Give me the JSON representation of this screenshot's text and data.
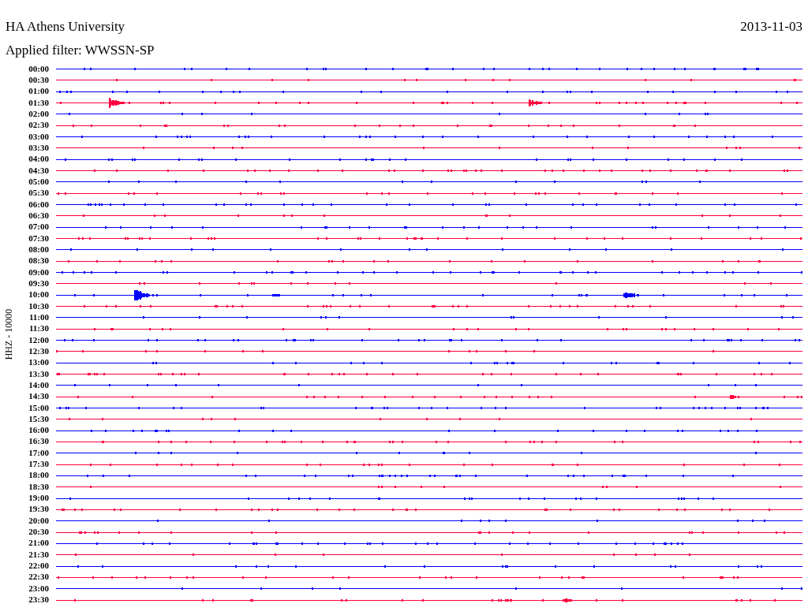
{
  "header": {
    "station": "HA Athens University",
    "date": "2013-11-03",
    "filter": "Applied filter: WWSSN-SP"
  },
  "axis_label": "HHZ - 10000",
  "rows": [
    {
      "time": "00:00",
      "color": "#0000ff"
    },
    {
      "time": "00:30",
      "color": "#ff0040"
    },
    {
      "time": "01:00",
      "color": "#0000ff"
    },
    {
      "time": "01:30",
      "color": "#ff0040"
    },
    {
      "time": "02:00",
      "color": "#0000ff"
    },
    {
      "time": "02:30",
      "color": "#ff0040"
    },
    {
      "time": "03:00",
      "color": "#0000ff"
    },
    {
      "time": "03:30",
      "color": "#ff0040"
    },
    {
      "time": "04:00",
      "color": "#0000ff"
    },
    {
      "time": "04:30",
      "color": "#ff0040"
    },
    {
      "time": "05:00",
      "color": "#0000ff"
    },
    {
      "time": "05:30",
      "color": "#ff0040"
    },
    {
      "time": "06:00",
      "color": "#0000ff"
    },
    {
      "time": "06:30",
      "color": "#ff0040"
    },
    {
      "time": "07:00",
      "color": "#0000ff"
    },
    {
      "time": "07:30",
      "color": "#ff0040"
    },
    {
      "time": "08:00",
      "color": "#0000ff"
    },
    {
      "time": "08:30",
      "color": "#ff0040"
    },
    {
      "time": "09:00",
      "color": "#0000ff"
    },
    {
      "time": "09:30",
      "color": "#ff0040"
    },
    {
      "time": "10:00",
      "color": "#0000ff"
    },
    {
      "time": "10:30",
      "color": "#ff0040"
    },
    {
      "time": "11:00",
      "color": "#0000ff"
    },
    {
      "time": "11:30",
      "color": "#ff0040"
    },
    {
      "time": "12:00",
      "color": "#0000ff"
    },
    {
      "time": "12:30",
      "color": "#ff0040"
    },
    {
      "time": "13:00",
      "color": "#0000ff"
    },
    {
      "time": "13:30",
      "color": "#ff0040"
    },
    {
      "time": "14:00",
      "color": "#0000ff"
    },
    {
      "time": "14:30",
      "color": "#ff0040"
    },
    {
      "time": "15:00",
      "color": "#0000ff"
    },
    {
      "time": "15:30",
      "color": "#ff0040"
    },
    {
      "time": "16:00",
      "color": "#0000ff"
    },
    {
      "time": "16:30",
      "color": "#ff0040"
    },
    {
      "time": "17:00",
      "color": "#0000ff"
    },
    {
      "time": "17:30",
      "color": "#ff0040"
    },
    {
      "time": "18:00",
      "color": "#0000ff"
    },
    {
      "time": "18:30",
      "color": "#ff0040"
    },
    {
      "time": "19:00",
      "color": "#0000ff"
    },
    {
      "time": "19:30",
      "color": "#ff0040"
    },
    {
      "time": "20:00",
      "color": "#0000ff"
    },
    {
      "time": "20:30",
      "color": "#ff0040"
    },
    {
      "time": "21:00",
      "color": "#0000ff"
    },
    {
      "time": "21:30",
      "color": "#ff0040"
    },
    {
      "time": "22:00",
      "color": "#0000ff"
    },
    {
      "time": "22:30",
      "color": "#ff0040"
    },
    {
      "time": "23:00",
      "color": "#0000ff"
    },
    {
      "time": "23:30",
      "color": "#ff0040"
    }
  ]
}
